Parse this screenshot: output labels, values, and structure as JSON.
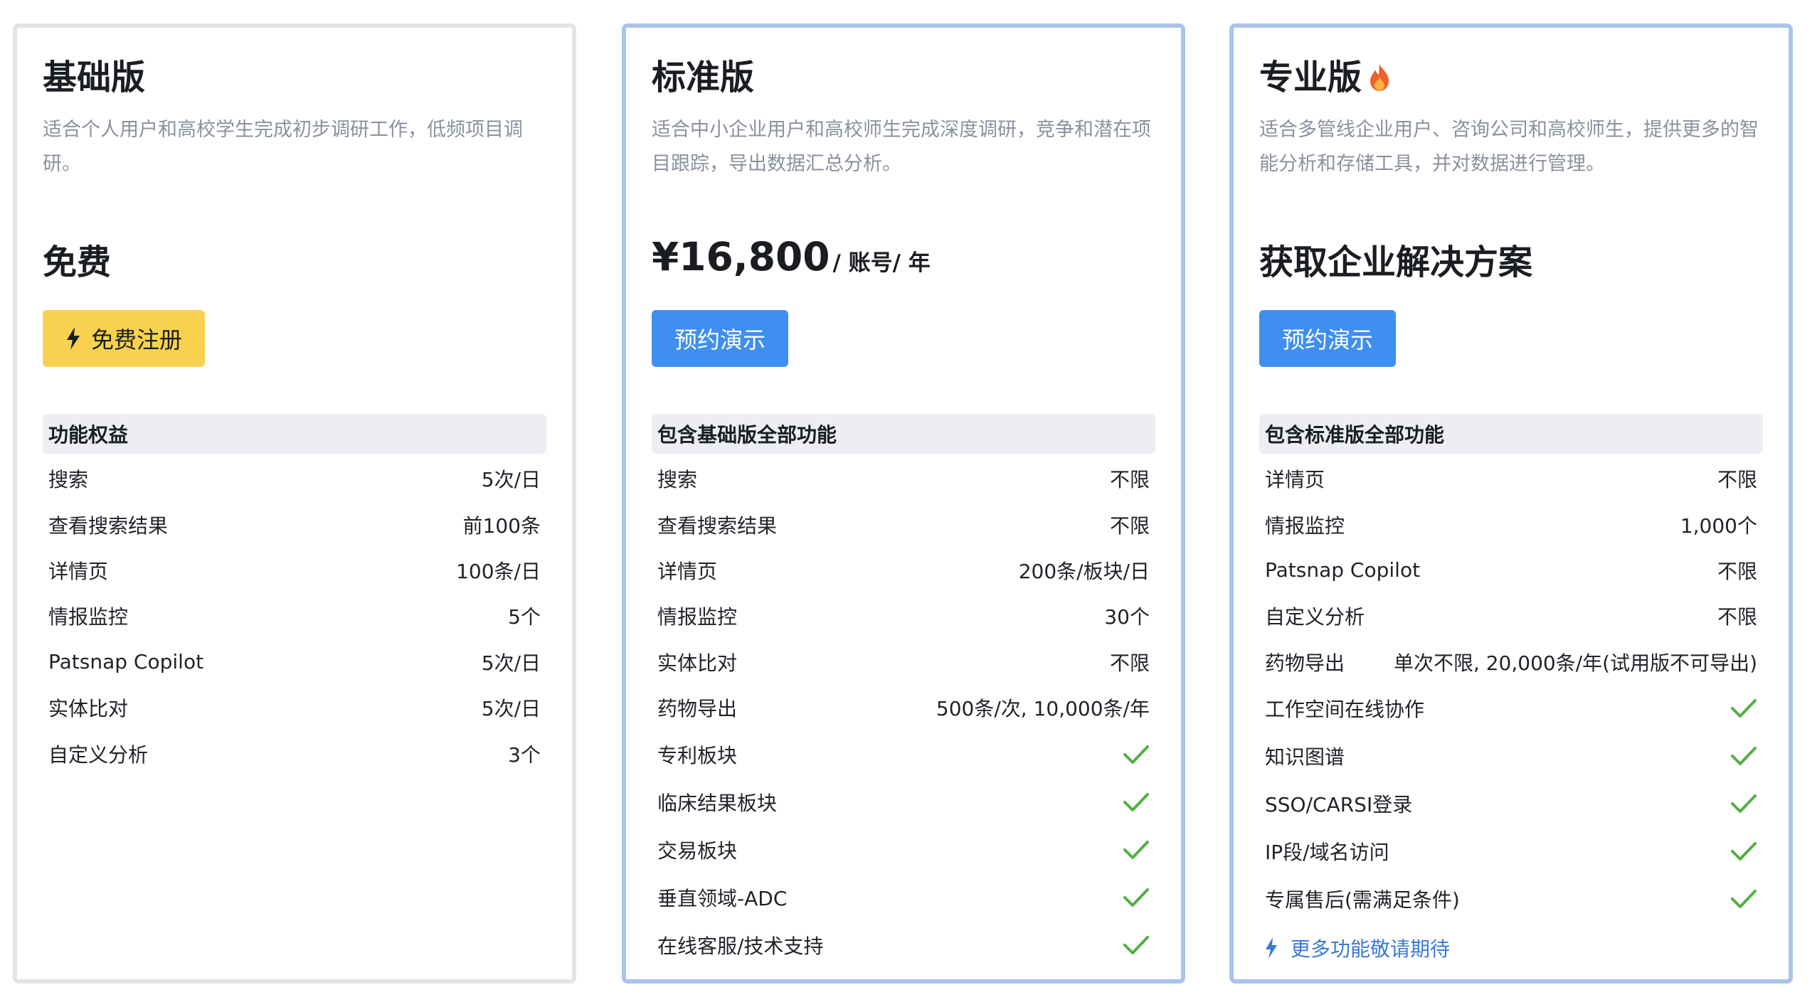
{
  "plans": {
    "basic": {
      "title": "基础版",
      "description": "适合个人用户和高校学生完成初步调研工作，低频项目调研。",
      "price_text": "免费",
      "cta_label": "免费注册",
      "cta_icon": "bolt-icon",
      "features_header": "功能权益",
      "features": [
        {
          "name": "搜索",
          "value": "5次/日"
        },
        {
          "name": "查看搜索结果",
          "value": "前100条"
        },
        {
          "name": "详情页",
          "value": "100条/日"
        },
        {
          "name": "情报监控",
          "value": "5个"
        },
        {
          "name": "Patsnap Copilot",
          "value": "5次/日"
        },
        {
          "name": "实体比对",
          "value": "5次/日"
        },
        {
          "name": "自定义分析",
          "value": "3个"
        }
      ]
    },
    "standard": {
      "title": "标准版",
      "description": "适合中小企业用户和高校师生完成深度调研，竞争和潜在项目跟踪，导出数据汇总分析。",
      "price_amount": "¥16,800",
      "price_unit": "/ 账号/ 年",
      "cta_label": "预约演示",
      "features_header": "包含基础版全部功能",
      "features": [
        {
          "name": "搜索",
          "value": "不限"
        },
        {
          "name": "查看搜索结果",
          "value": "不限"
        },
        {
          "name": "详情页",
          "value": "200条/板块/日"
        },
        {
          "name": "情报监控",
          "value": "30个"
        },
        {
          "name": "实体比对",
          "value": "不限"
        },
        {
          "name": "药物导出",
          "value": "500条/次, 10,000条/年"
        }
      ],
      "checked_features": [
        {
          "name": "专利板块"
        },
        {
          "name": "临床结果板块"
        },
        {
          "name": "交易板块"
        },
        {
          "name": "垂直领域-ADC"
        },
        {
          "name": "在线客服/技术支持"
        }
      ]
    },
    "pro": {
      "title": "专业版",
      "title_icon": "fire-icon",
      "description": "适合多管线企业用户、咨询公司和高校师生，提供更多的智能分析和存储工具，并对数据进行管理。",
      "price_text": "获取企业解决方案",
      "cta_label": "预约演示",
      "features_header": "包含标准版全部功能",
      "features": [
        {
          "name": "详情页",
          "value": "不限"
        },
        {
          "name": "情报监控",
          "value": "1,000个"
        },
        {
          "name": "Patsnap Copilot",
          "value": "不限"
        },
        {
          "name": "自定义分析",
          "value": "不限"
        },
        {
          "name": "药物导出",
          "value": "单次不限, 20,000条/年(试用版不可导出)"
        }
      ],
      "checked_features": [
        {
          "name": "工作空间在线协作"
        },
        {
          "name": "知识图谱"
        },
        {
          "name": "SSO/CARSI登录"
        },
        {
          "name": "IP段/域名访问"
        },
        {
          "name": "专属售后(需满足条件)"
        }
      ],
      "more_link": "更多功能敬请期待",
      "more_icon": "bolt-icon"
    }
  },
  "colors": {
    "card_border_default": "#e3e4e6",
    "card_border_highlight": "#a9c4ea",
    "cta_yellow": "#f8d24e",
    "cta_blue": "#3f8ef2",
    "check_green": "#52b043",
    "link_blue": "#3a78d6"
  }
}
